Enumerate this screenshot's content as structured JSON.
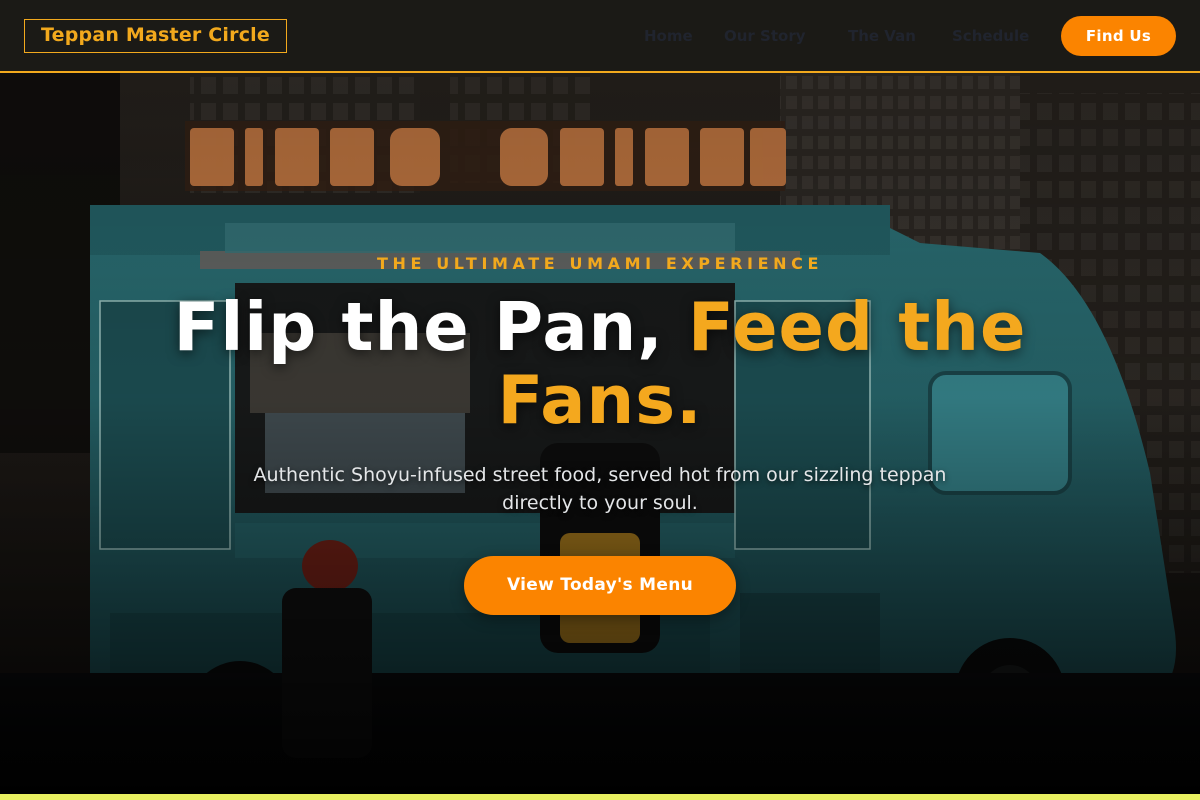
{
  "header": {
    "logo": "Teppan Master Circle",
    "nav": [
      "Home",
      "Our Story",
      "The Van",
      "Schedule"
    ],
    "cta_label": "Find Us"
  },
  "hero": {
    "kicker": "THE ULTIMATE UMAMI EXPERIENCE",
    "headline_part1": "Flip the Pan,",
    "headline_part2": "Feed the Fans.",
    "subtext": "Authentic Shoyu-infused street food, served hot from our sizzling teppan directly to your soul.",
    "cta_label": "View Today's Menu"
  },
  "colors": {
    "accent": "#f2a91d",
    "button": "#fb8400",
    "header_bg": "#1b1a16"
  }
}
